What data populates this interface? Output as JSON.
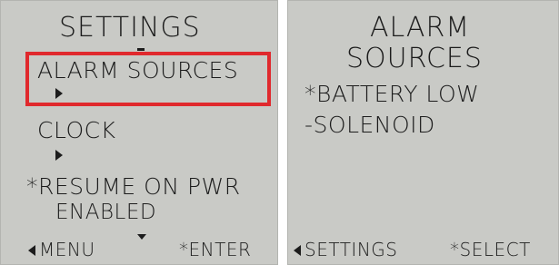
{
  "left_screen": {
    "title": "SETTINGS",
    "menu_items": [
      {
        "label": "ALARM SOURCES",
        "prefix": "",
        "selected": true
      },
      {
        "label": "CLOCK",
        "prefix": ""
      },
      {
        "label": "RESUME ON PWR",
        "prefix": "*",
        "value": "ENABLED"
      }
    ],
    "softkeys": {
      "left": "MENU",
      "right": "*ENTER"
    },
    "highlight_color": "#e0292d"
  },
  "right_screen": {
    "title_line1": "ALARM",
    "title_line2": "SOURCES",
    "options": [
      {
        "label": "BATTERY LOW",
        "prefix": "*"
      },
      {
        "label": "SOLENOID",
        "prefix": "-"
      }
    ],
    "softkeys": {
      "left": "SETTINGS",
      "right": "*SELECT"
    }
  },
  "icons": [
    "submenu-arrow-icon",
    "scroll-down-icon",
    "back-arrow-icon"
  ]
}
